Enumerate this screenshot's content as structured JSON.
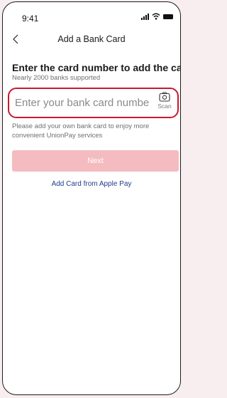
{
  "status_bar": {
    "time": "9:41"
  },
  "nav": {
    "title": "Add a Bank Card"
  },
  "main": {
    "heading": "Enter the card number to add the card",
    "subheading": "Nearly 2000 banks supported",
    "card_input": {
      "placeholder": "Enter your bank card number",
      "value": ""
    },
    "scan_label": "Scan",
    "hint": "Please add your own bank card to enjoy more convenient UnionPay services",
    "next_label": "Next",
    "apple_pay_link": "Add Card from Apple Pay"
  },
  "colors": {
    "accent": "#c8192e",
    "next_disabled": "#f4bcc0",
    "link": "#1f3d8a",
    "page_bg": "#f8eef0"
  },
  "icons": {
    "back": "chevron-left-icon",
    "scan": "camera-icon",
    "signal": "signal-icon",
    "wifi": "wifi-icon",
    "battery": "battery-icon"
  }
}
